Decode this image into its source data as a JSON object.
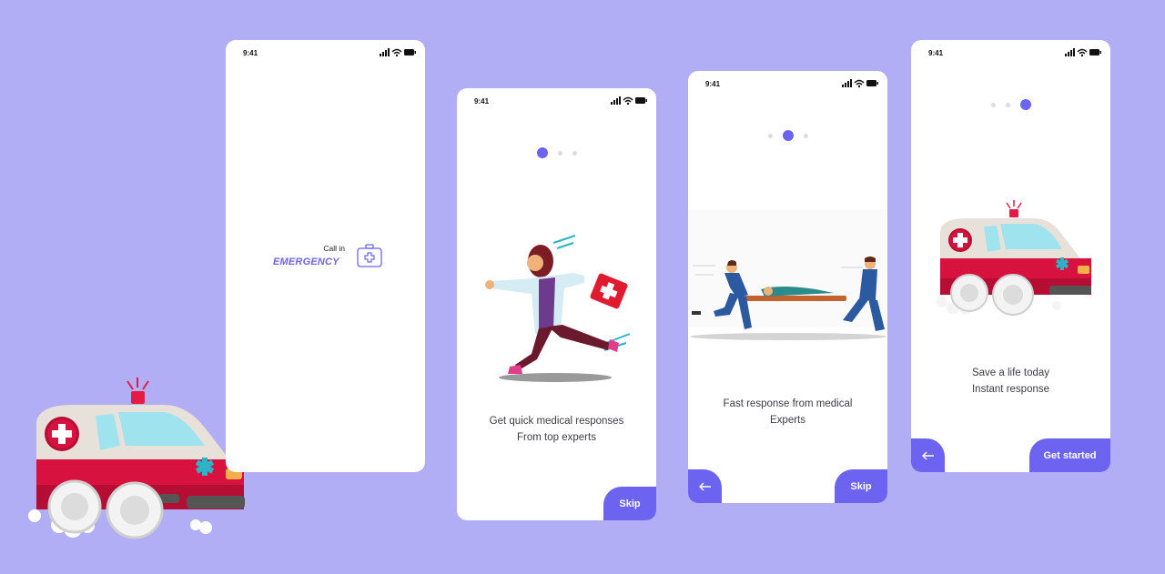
{
  "status": {
    "time": "9:41"
  },
  "splash": {
    "logo_small": "Call in",
    "logo_big": "EMERGENCY"
  },
  "onboarding": [
    {
      "caption_line1": "Get quick medical responses",
      "caption_line2": "From top experts",
      "skip_label": "Skip"
    },
    {
      "caption_line1": "Fast response from medical",
      "caption_line2": "Experts",
      "skip_label": "Skip"
    },
    {
      "caption_line1": "Save a life today",
      "caption_line2": "Instant response",
      "start_label": "Get started"
    }
  ],
  "colors": {
    "accent": "#6c63f0",
    "background": "#b1aef5",
    "dot_inactive": "#dcdce4",
    "ambulance_red": "#d8123f"
  },
  "icons": {
    "back": "arrow-left-icon",
    "logo": "medical-kit-icon",
    "signal": "signal-icon",
    "wifi": "wifi-icon",
    "battery": "battery-icon"
  }
}
